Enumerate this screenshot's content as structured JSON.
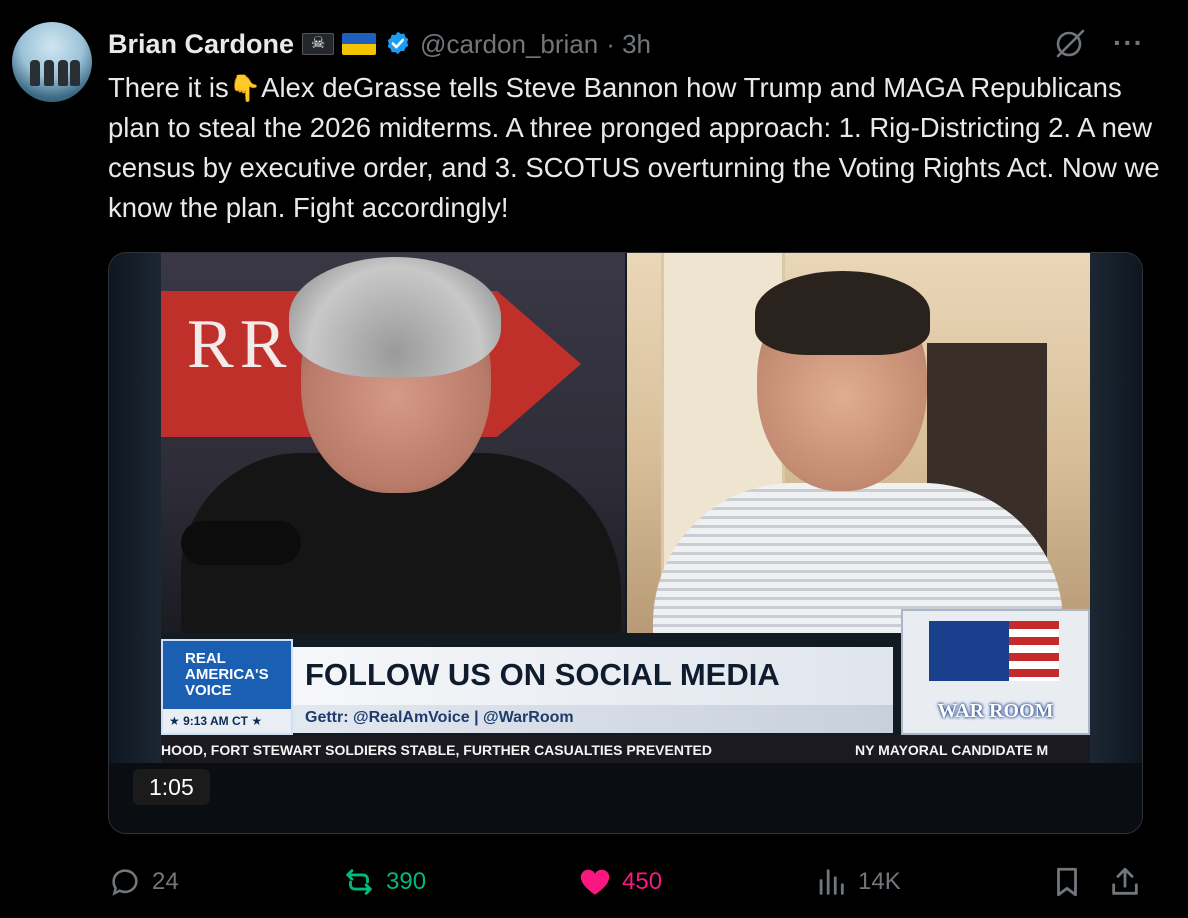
{
  "author": {
    "name": "Brian Cardone",
    "handle": "@cardon_brian",
    "time": "· 3h",
    "badges": [
      "pirate-flag-icon",
      "ukraine-flag-icon",
      "verified-badge-icon"
    ]
  },
  "tweet": {
    "text_before_emoji": "There it is",
    "emoji": "👇",
    "text_after_emoji": "Alex deGrasse tells Steve Bannon how Trump and MAGA Republicans plan to steal the 2026 midterms. A three pronged approach: 1. Rig-Districting 2. A new census by executive order, and 3. SCOTUS overturning the Voting Rights Act. Now we know the plan. Fight accordingly!"
  },
  "video": {
    "duration": "1:05",
    "banner_letters": "RR   M",
    "network_logo": "REAL AMERICA'S VOICE",
    "timestamp": "★ 9:13 AM CT ★",
    "headline": "FOLLOW US ON SOCIAL MEDIA",
    "social_line": "Gettr: @RealAmVoice | @WarRoom",
    "show_logo": "WAR ROOM",
    "ticker_left": "HOOD, FORT STEWART SOLDIERS STABLE, FURTHER CASUALTIES PREVENTED",
    "ticker_right": "NY MAYORAL CANDIDATE M"
  },
  "actions": {
    "replies": "24",
    "retweets": "390",
    "likes": "450",
    "views": "14K"
  },
  "colors": {
    "background": "#000000",
    "text": "#e7e9ea",
    "muted": "#71767b",
    "verified": "#1d9bf0",
    "retweet": "#00ba7c",
    "like": "#f91880"
  }
}
